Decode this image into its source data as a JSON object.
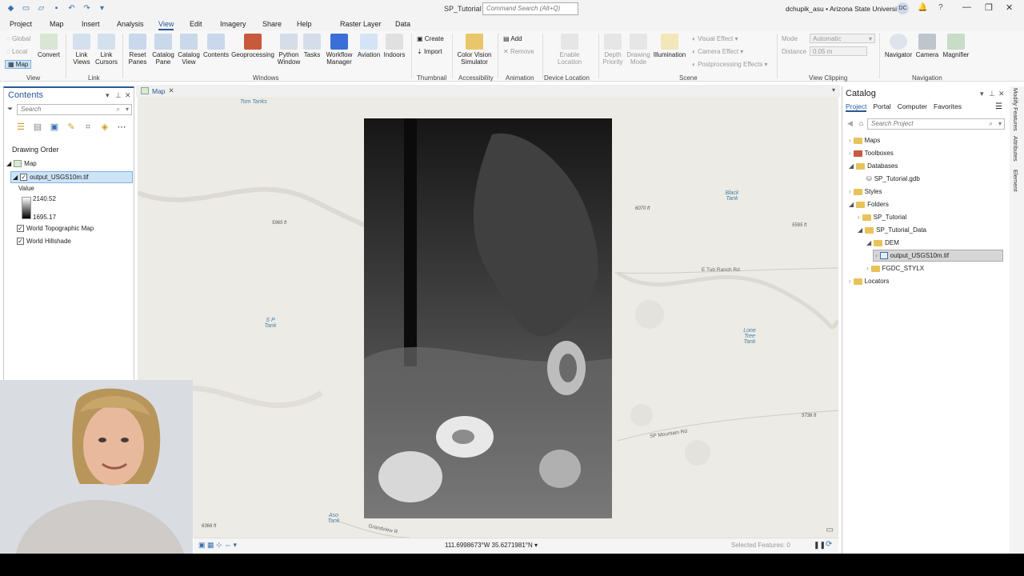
{
  "window": {
    "title": "SP_Tutorial",
    "command_search_placeholder": "Command Search (Alt+Q)",
    "user": "dchupik_asu • Arizona State University",
    "avatar_initials": "DC"
  },
  "ribbon_tabs": [
    "Project",
    "Map",
    "Insert",
    "Analysis",
    "View",
    "Edit",
    "Imagery",
    "Share",
    "Help",
    "Raster Layer",
    "Data"
  ],
  "active_tab": "View",
  "ribbon": {
    "view_group": {
      "label": "View",
      "items": [
        "Global",
        "Local",
        "Map"
      ],
      "convert": "Convert"
    },
    "link_group": {
      "label": "Link",
      "link_views": "Link Views",
      "link_cursors": "Link Cursors"
    },
    "windows_group": {
      "label": "Windows",
      "items": [
        "Reset Panes",
        "Catalog Pane",
        "Catalog View",
        "Contents",
        "Geoprocessing",
        "Python Window",
        "Tasks",
        "Workflow Manager",
        "Aviation",
        "Indoors"
      ]
    },
    "thumbnail_group": {
      "label": "Thumbnail",
      "create": "Create",
      "import": "Import"
    },
    "accessibility_group": {
      "label": "Accessibility",
      "item": "Color Vision Simulator"
    },
    "animation_group": {
      "label": "Animation",
      "add": "Add",
      "remove": "Remove"
    },
    "device_group": {
      "label": "Device Location",
      "item": "Enable Location"
    },
    "scene_group": {
      "label": "Scene",
      "items": [
        "Depth Priority",
        "Drawing Mode",
        "Illumination"
      ],
      "visual_effect": "Visual Effect",
      "camera_effect": "Camera Effect",
      "postprocessing": "Postprocessing Effects"
    },
    "clipping_group": {
      "label": "View Clipping",
      "mode_label": "Mode",
      "mode_value": "Automatic",
      "distance_label": "Distance",
      "distance_value": "0.05 m"
    },
    "navigation_group": {
      "label": "Navigation",
      "items": [
        "Navigator",
        "Camera",
        "Magnifier"
      ]
    }
  },
  "contents": {
    "title": "Contents",
    "search_placeholder": "Search",
    "drawing_order": "Drawing Order",
    "map_name": "Map",
    "layer": "output_USGS10m.tif",
    "value_label": "Value",
    "value_high": "2140.52",
    "value_low": "1695.17",
    "basemaps": [
      "World Topographic Map",
      "World Hillshade"
    ]
  },
  "map_view": {
    "tab": "Map",
    "places": [
      "Tom Tanks",
      "Black Tank",
      "S P Tank",
      "Lone Tree Tank",
      "Aso Tank"
    ],
    "elevations": [
      "5965 ft",
      "6070 ft",
      "5595 ft",
      "5736 ft",
      "6366 ft"
    ],
    "roads": [
      "E Tub Ranch Rd",
      "SP Mountain Rd",
      "Grandview R"
    ],
    "coordinates": "111.6998673°W 35.6271981°N",
    "selected_features": "Selected Features: 0"
  },
  "catalog": {
    "title": "Catalog",
    "tabs": [
      "Project",
      "Portal",
      "Computer",
      "Favorites"
    ],
    "search_placeholder": "Search Project",
    "items": [
      "Maps",
      "Toolboxes",
      "Databases",
      "SP_Tutorial.gdb",
      "Styles",
      "Folders",
      "SP_Tutorial",
      "SP_Tutorial_Data",
      "DEM",
      "output_USGS10m.tif",
      "FGDC_STYLX",
      "Locators"
    ]
  },
  "side_tabs": [
    "Modify Features",
    "Attributes",
    "Element"
  ]
}
